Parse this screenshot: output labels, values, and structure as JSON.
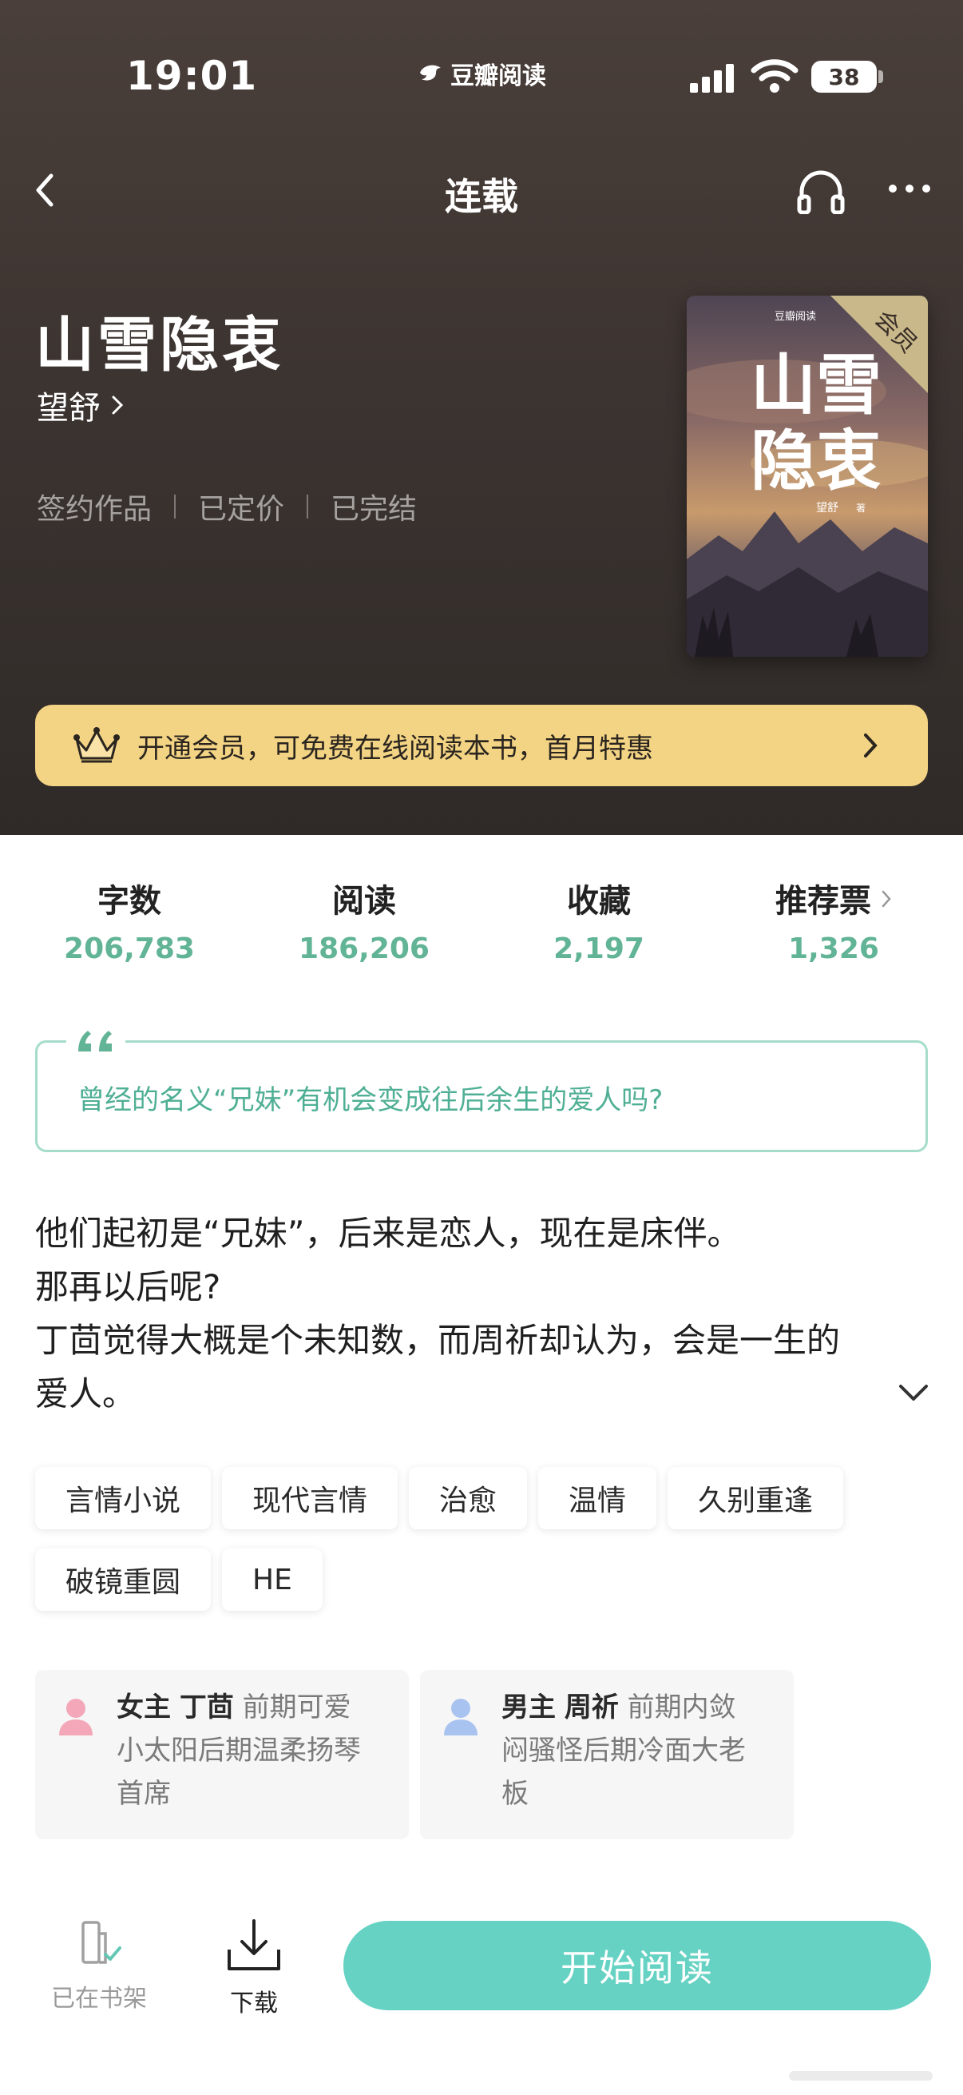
{
  "status_bar": {
    "time": "19:01",
    "app_name": "豆瓣阅读",
    "battery": "38"
  },
  "nav": {
    "title": "连载"
  },
  "book": {
    "title": "山雪隐衷",
    "author": "望舒",
    "meta": [
      "签约作品",
      "已定价",
      "已完结"
    ],
    "cover": {
      "badge": "会员",
      "brand": "豆瓣阅读",
      "title_line1": "山雪",
      "title_line2": "隐衷",
      "author": "望舒",
      "author_suffix": "著"
    }
  },
  "vip_banner": {
    "text": "开通会员，可免费在线阅读本书，首月特惠"
  },
  "stats": [
    {
      "label": "字数",
      "value": "206,783"
    },
    {
      "label": "阅读",
      "value": "186,206"
    },
    {
      "label": "收藏",
      "value": "2,197"
    },
    {
      "label": "推荐票",
      "value": "1,326"
    }
  ],
  "quote": {
    "text": "曾经的名义“兄妹”有机会变成往后余生的爱人吗?"
  },
  "intro": {
    "lines": [
      "他们起初是“兄妹”，后来是恋人，现在是床伴。",
      "那再以后呢?",
      "丁茴觉得大概是个未知数，而周祈却认为，会是一生的",
      "爱人。"
    ]
  },
  "tags": [
    "言情小说",
    "现代言情",
    "治愈",
    "温情",
    "久别重逢",
    "破镜重圆",
    "HE"
  ],
  "characters": [
    {
      "role": "女主",
      "name": "丁茴",
      "desc": "前期可爱小太阳后期温柔扬琴首席",
      "lines": [
        "前期可爱",
        "小太阳后期温柔扬琴",
        "首席"
      ],
      "color": "#f3a7b9"
    },
    {
      "role": "男主",
      "name": "周祈",
      "desc": "前期内敛闷骚怪后期冷面大老板",
      "lines": [
        "前期内敛",
        "闷骚怪后期冷面大老",
        "板"
      ],
      "color": "#a9c3f0"
    }
  ],
  "bottom_bar": {
    "shelf_label": "已在书架",
    "download_label": "下载",
    "read_button": "开始阅读"
  },
  "colors": {
    "accent_green": "#62b497",
    "vip_gold": "#f3d484",
    "read_button": "#66d2c3",
    "header_bg": "#3c3431"
  },
  "icons": [
    "back-icon",
    "headphone-icon",
    "more-icon",
    "crown-icon",
    "quote-icon",
    "chevron-down-icon",
    "bookshelf-check-icon",
    "download-icon"
  ]
}
